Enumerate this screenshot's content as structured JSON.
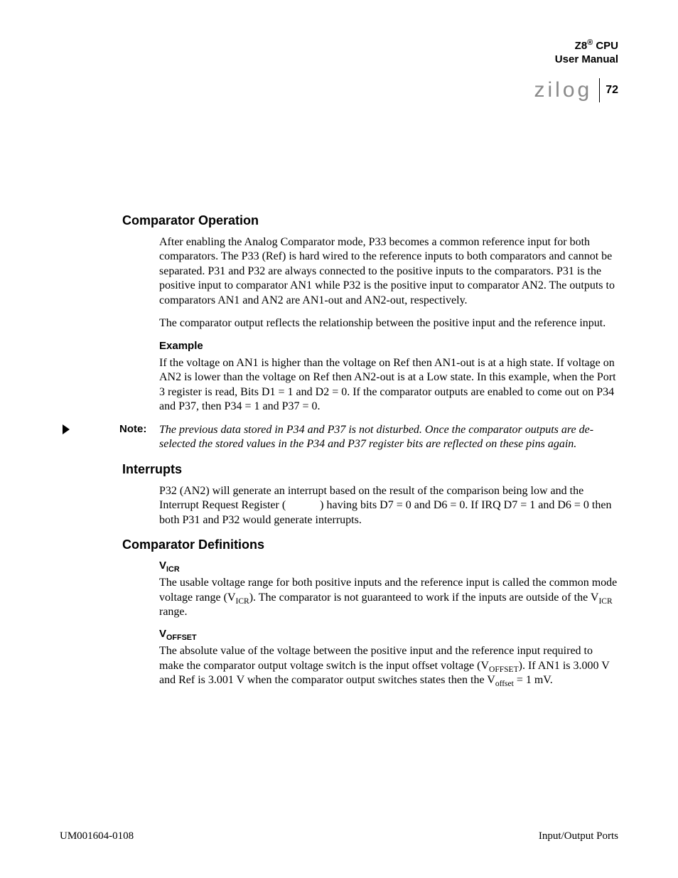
{
  "header": {
    "product": "Z8",
    "reg": "®",
    "suffix": " CPU",
    "subtitle": "User Manual",
    "logo": "zilog",
    "page_number": "72"
  },
  "sections": {
    "comp_op": {
      "title": "Comparator Operation",
      "p1": "After enabling the Analog Comparator mode, P33 becomes a common reference input for both comparators. The P33 (Ref) is hard wired to the reference inputs to both comparators and cannot be separated. P31 and P32 are always connected to the positive inputs to the comparators. P31 is the positive input to comparator AN1 while P32 is the positive input to comparator AN2. The outputs to comparators AN1 and AN2 are AN1-out and AN2-out, respectively.",
      "p2": "The comparator output reflects the relationship between the positive input and the reference input.",
      "example_head": "Example",
      "example_body": "If the voltage on AN1 is higher than the voltage on Ref then AN1-out is at a high state. If voltage on AN2 is lower than the voltage on Ref then AN2-out is at a Low state. In this example, when the Port 3 register is read, Bits D1 = 1 and D2 = 0. If the comparator outputs are enabled to come out on P34 and P37, then P34 = 1 and P37 = 0.",
      "note_label": "Note:",
      "note_body": "The previous data stored in P34 and P37 is not disturbed. Once the comparator outputs are de-selected the stored values in the P34 and P37 register bits are reflected on these pins again."
    },
    "interrupts": {
      "title": "Interrupts",
      "p1_a": "P32 (AN2) will generate an interrupt based on the result of the comparison being low and the Interrupt Request Register (",
      "p1_b": ") having bits D7 = 0 and D6 = 0. If IRQ D7 = 1 and D6 = 0 then both P31 and P32 would generate interrupts."
    },
    "comp_def": {
      "title": "Comparator Definitions",
      "vicr_head_base": "V",
      "vicr_head_sub": "ICR",
      "vicr_a": "The usable voltage range for both positive inputs and the reference input is called the common mode voltage range (V",
      "vicr_sub1": "ICR",
      "vicr_b": "). The comparator is not guaranteed to work if the inputs are outside of the V",
      "vicr_sub2": "ICR",
      "vicr_c": " range.",
      "voff_head_base": "V",
      "voff_head_sub": "OFFSET",
      "voff_a": "The absolute value of the voltage between the positive input and the reference input required to make the comparator output voltage switch is the input offset voltage (V",
      "voff_sub1": "OFFSET",
      "voff_b": "). If AN1 is 3.000 V and Ref is 3.001 V when the comparator output switches states then the V",
      "voff_sub2": "offset",
      "voff_c": " = 1 mV."
    }
  },
  "footer": {
    "left": "UM001604-0108",
    "right": "Input/Output Ports"
  }
}
